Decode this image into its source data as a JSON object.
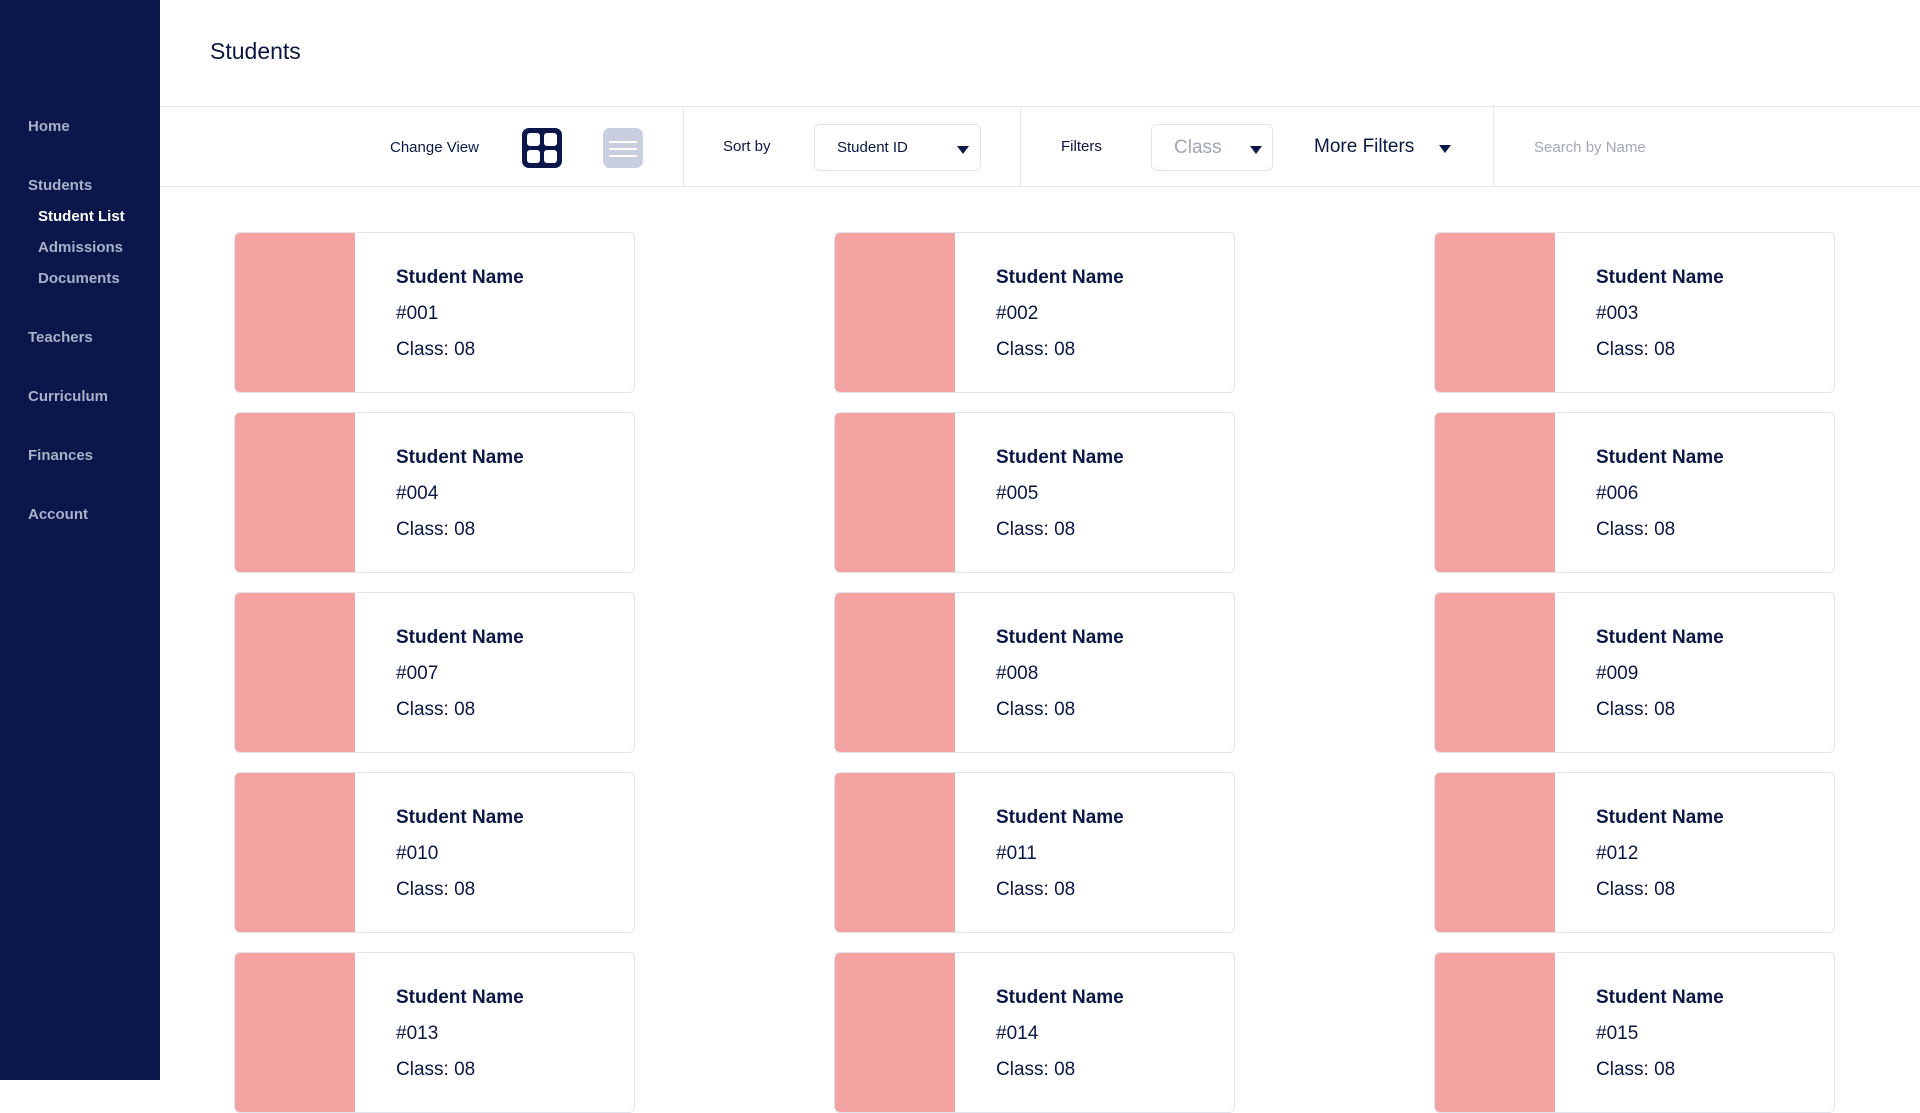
{
  "page_title": "Students",
  "sidebar": {
    "items": [
      {
        "label": "Home"
      },
      {
        "label": "Students"
      },
      {
        "label": "Teachers"
      },
      {
        "label": "Curriculum"
      },
      {
        "label": "Finances"
      },
      {
        "label": "Account"
      }
    ],
    "students_sub": [
      {
        "label": "Student List",
        "active": true
      },
      {
        "label": "Admissions",
        "active": false
      },
      {
        "label": "Documents",
        "active": false
      }
    ]
  },
  "toolbar": {
    "change_view_label": "Change View",
    "view_modes": [
      "grid-view-icon",
      "list-view-icon"
    ],
    "active_view": "grid",
    "sort_label": "Sort by",
    "sort_value": "Student ID",
    "filters_label": "Filters",
    "class_placeholder": "Class",
    "more_filters_label": "More Filters",
    "search_placeholder": "Search by Name"
  },
  "colors": {
    "sidebar": "#0b174b",
    "text": "#0b1746",
    "photo_placeholder": "#f5a2a2",
    "muted": "#a9b0c8"
  },
  "students": [
    {
      "name": "Student Name",
      "id": "#001",
      "class": "Class: 08"
    },
    {
      "name": "Student Name",
      "id": "#002",
      "class": "Class: 08"
    },
    {
      "name": "Student Name",
      "id": "#003",
      "class": "Class: 08"
    },
    {
      "name": "Student Name",
      "id": "#004",
      "class": "Class: 08"
    },
    {
      "name": "Student Name",
      "id": "#005",
      "class": "Class: 08"
    },
    {
      "name": "Student Name",
      "id": "#006",
      "class": "Class: 08"
    },
    {
      "name": "Student Name",
      "id": "#007",
      "class": "Class: 08"
    },
    {
      "name": "Student Name",
      "id": "#008",
      "class": "Class: 08"
    },
    {
      "name": "Student Name",
      "id": "#009",
      "class": "Class: 08"
    },
    {
      "name": "Student Name",
      "id": "#010",
      "class": "Class: 08"
    },
    {
      "name": "Student Name",
      "id": "#011",
      "class": "Class: 08"
    },
    {
      "name": "Student Name",
      "id": "#012",
      "class": "Class: 08"
    },
    {
      "name": "Student Name",
      "id": "#013",
      "class": "Class: 08"
    },
    {
      "name": "Student Name",
      "id": "#014",
      "class": "Class: 08"
    },
    {
      "name": "Student Name",
      "id": "#015",
      "class": "Class: 08"
    }
  ]
}
